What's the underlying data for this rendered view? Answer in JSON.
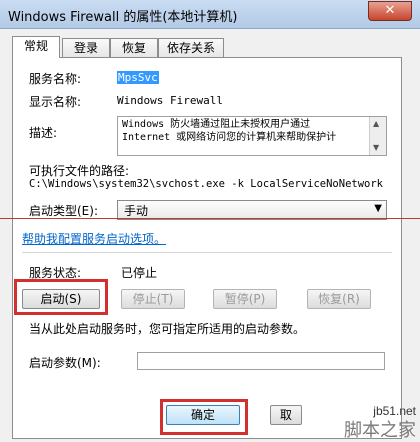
{
  "window": {
    "title": "Windows Firewall 的属性(本地计算机)",
    "close_glyph": "✕"
  },
  "tabs": [
    {
      "label": "常规",
      "active": true
    },
    {
      "label": "登录",
      "active": false
    },
    {
      "label": "恢复",
      "active": false
    },
    {
      "label": "依存关系",
      "active": false
    }
  ],
  "general": {
    "service_name_label": "服务名称:",
    "service_name_value": "MpsSvc",
    "display_name_label": "显示名称:",
    "display_name_value": "Windows Firewall",
    "description_label": "描述:",
    "description_value": "Windows 防火墙通过阻止未授权用户通过\nInternet 或网络访问您的计算机来帮助保护计",
    "exe_path_label": "可执行文件的路径:",
    "exe_path_value": "C:\\Windows\\system32\\svchost.exe -k LocalServiceNoNetwork",
    "startup_type_label": "启动类型(E):",
    "startup_type_value": "手动",
    "help_link": "帮助我配置服务启动选项。",
    "service_status_label": "服务状态:",
    "service_status_value": "已停止",
    "buttons": {
      "start": "启动(S)",
      "stop": "停止(T)",
      "pause": "暂停(P)",
      "resume": "恢复(R)"
    },
    "hint": "当从此处启动服务时，您可指定所适用的启动参数。",
    "start_params_label": "启动参数(M):",
    "start_params_value": ""
  },
  "footer": {
    "ok": "确定",
    "cancel": "取"
  },
  "watermark": {
    "url": "jb51.net",
    "name": "脚本之家"
  },
  "colors": {
    "annotation_red": "#d32f2f",
    "link": "#0066cc",
    "selection": "#3399ff"
  }
}
